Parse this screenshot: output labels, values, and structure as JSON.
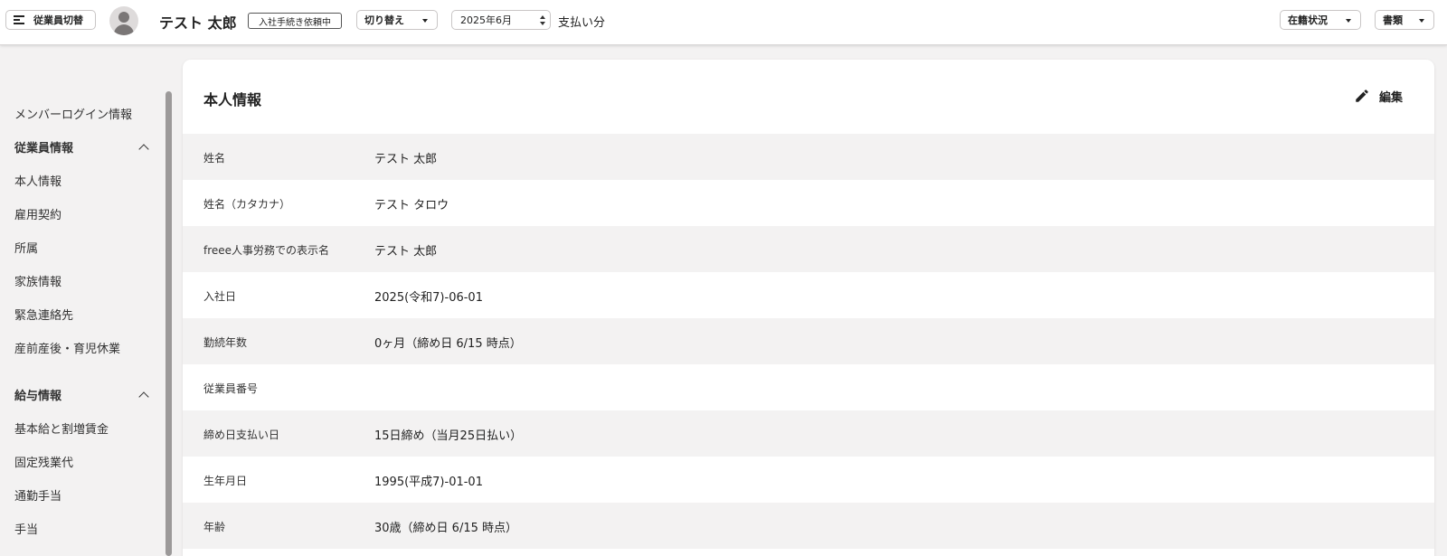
{
  "topbar": {
    "switch_label": "従業員切替",
    "employee_name": "テスト 太郎",
    "status_tag": "入社手続き依頼中",
    "toggle_label": "切り替え",
    "month_value": "2025年6月",
    "pay_label": "支払い分",
    "enrollment_label": "在籍状況",
    "documents_label": "書類"
  },
  "sidebar": {
    "member_login": "メンバーログイン情報",
    "employee_section": "従業員情報",
    "employee_items": [
      "本人情報",
      "雇用契約",
      "所属",
      "家族情報",
      "緊急連絡先",
      "産前産後・育児休業"
    ],
    "salary_section": "給与情報",
    "salary_items": [
      "基本給と割増賃金",
      "固定残業代",
      "通勤手当",
      "手当"
    ]
  },
  "card": {
    "title": "本人情報",
    "edit_label": "編集",
    "rows": [
      {
        "label": "姓名",
        "value": "テスト 太郎"
      },
      {
        "label": "姓名（カタカナ）",
        "value": "テスト タロウ"
      },
      {
        "label": "freee人事労務での表示名",
        "value": "テスト 太郎"
      },
      {
        "label": "入社日",
        "value": "2025(令和7)-06-01"
      },
      {
        "label": "勤続年数",
        "value": "0ヶ月（締め日 6/15 時点）"
      },
      {
        "label": "従業員番号",
        "value": ""
      },
      {
        "label": "締め日支払い日",
        "value": "15日締め（当月25日払い）"
      },
      {
        "label": "生年月日",
        "value": "1995(平成7)-01-01"
      },
      {
        "label": "年齢",
        "value": "30歳（締め日 6/15 時点）"
      }
    ]
  }
}
